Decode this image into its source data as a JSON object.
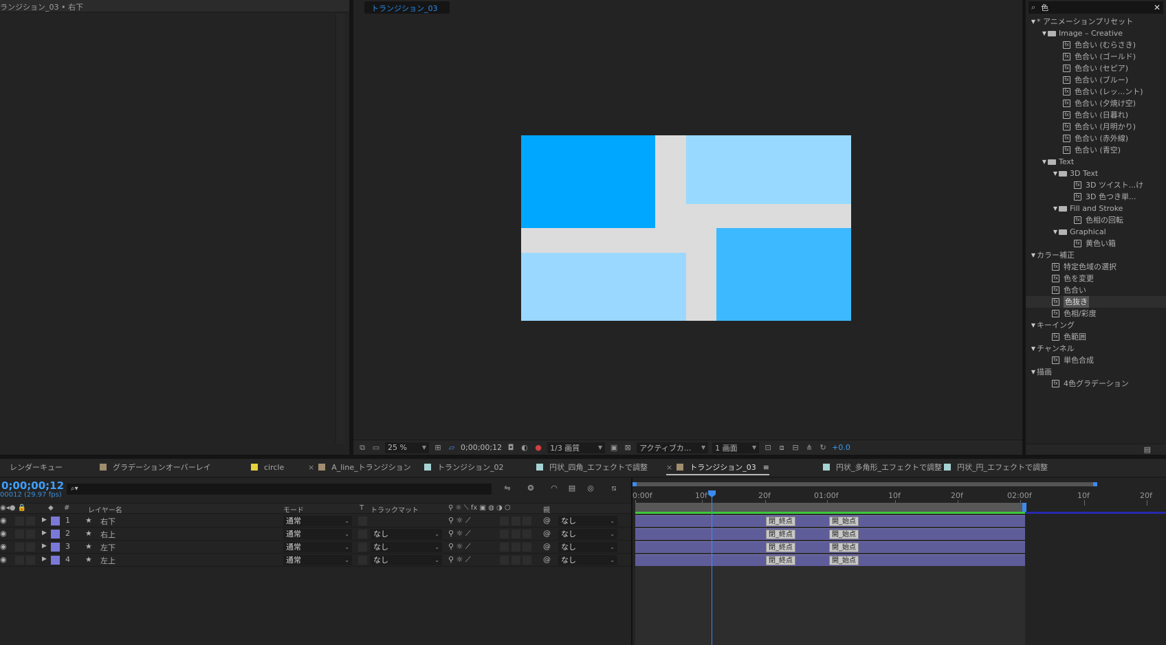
{
  "left_panel": {
    "header": "ランジション_03 • 右下"
  },
  "viewer": {
    "tab": "トランジション_03",
    "bar": {
      "zoom": "25 %",
      "timecode": "0;00;00;12",
      "resolution": "1/3 画質",
      "camera": "アクティブカ...",
      "views": "1 画面",
      "exposure": "+0.0"
    },
    "canvas_colors": {
      "top_left": "#00a7ff",
      "top_right": "#98d9ff",
      "bottom_left": "#9bd8ff",
      "bottom_right": "#3db9ff",
      "gap": "#dcdcdc"
    }
  },
  "effects": {
    "search_value": "色",
    "items": [
      {
        "label": "* アニメーションプリセット",
        "kind": "group",
        "indent": 0
      },
      {
        "label": "Image – Creative",
        "kind": "folder",
        "indent": 1
      },
      {
        "label": "色合い (むらさき)",
        "kind": "preset",
        "indent": 3
      },
      {
        "label": "色合い (ゴールド)",
        "kind": "preset",
        "indent": 3
      },
      {
        "label": "色合い (セピア)",
        "kind": "preset",
        "indent": 3
      },
      {
        "label": "色合い (ブルー)",
        "kind": "preset",
        "indent": 3
      },
      {
        "label": "色合い (レッ...ント)",
        "kind": "preset",
        "indent": 3
      },
      {
        "label": "色合い (夕焼け空)",
        "kind": "preset",
        "indent": 3
      },
      {
        "label": "色合い (日暮れ)",
        "kind": "preset",
        "indent": 3
      },
      {
        "label": "色合い (月明かり)",
        "kind": "preset",
        "indent": 3
      },
      {
        "label": "色合い (赤外線)",
        "kind": "preset",
        "indent": 3
      },
      {
        "label": "色合い (青空)",
        "kind": "preset",
        "indent": 3
      },
      {
        "label": "Text",
        "kind": "folder",
        "indent": 1
      },
      {
        "label": "3D Text",
        "kind": "folder",
        "indent": 2
      },
      {
        "label": "3D ツイスト...け",
        "kind": "preset",
        "indent": 4
      },
      {
        "label": "3D 色つき単...",
        "kind": "preset",
        "indent": 4
      },
      {
        "label": "Fill and Stroke",
        "kind": "folder",
        "indent": 2
      },
      {
        "label": "色相の回転",
        "kind": "preset",
        "indent": 4
      },
      {
        "label": "Graphical",
        "kind": "folder",
        "indent": 2
      },
      {
        "label": "黄色い箱",
        "kind": "preset",
        "indent": 4
      },
      {
        "label": "カラー補正",
        "kind": "group",
        "indent": 0
      },
      {
        "label": "特定色域の選択",
        "kind": "effect",
        "indent": 2
      },
      {
        "label": "色を変更",
        "kind": "effect",
        "indent": 2
      },
      {
        "label": "色合い",
        "kind": "effect",
        "indent": 2
      },
      {
        "label": "色抜き",
        "kind": "effect",
        "indent": 2,
        "highlight": true
      },
      {
        "label": "色相/彩度",
        "kind": "effect",
        "indent": 2
      },
      {
        "label": "キーイング",
        "kind": "group",
        "indent": 0
      },
      {
        "label": "色範囲",
        "kind": "effect",
        "indent": 2
      },
      {
        "label": "チャンネル",
        "kind": "group",
        "indent": 0
      },
      {
        "label": "単色合成",
        "kind": "effect",
        "indent": 2
      },
      {
        "label": "描画",
        "kind": "group",
        "indent": 0
      },
      {
        "label": "4色グラデーション",
        "kind": "effect",
        "indent": 2
      }
    ]
  },
  "comp_tabs": [
    {
      "label": "レンダーキュー",
      "swatch": ""
    },
    {
      "label": "グラデーションオーバーレイ",
      "swatch": "#a08c6e"
    },
    {
      "label": "circle",
      "swatch": "#e6d23c"
    },
    {
      "label": "A_line_トランジション",
      "swatch": "#a08c6e",
      "close": "×"
    },
    {
      "label": "トランジション_02",
      "swatch": "#a6d2d2"
    },
    {
      "label": "円状_四角_エフェクトで調整",
      "swatch": "#a6d2d2"
    },
    {
      "label": "トランジション_03",
      "swatch": "#a08c6e",
      "close": "×",
      "menu": "≡",
      "active": true
    },
    {
      "label": "円状_多角形_エフェクトで調整",
      "swatch": "#a6d2d2"
    },
    {
      "label": "円状_円_エフェクトで調整",
      "swatch": "#a6d2d2"
    }
  ],
  "timeline": {
    "timecode": "0;00;00;12",
    "fps": "00012 (29.97 fps)",
    "search_placeholder": "⌕▾",
    "columns": {
      "num": "#",
      "name": "レイヤー名",
      "mode": "モード",
      "t": "T",
      "trkmat": "トラックマット",
      "parent": "親"
    },
    "layers": [
      {
        "num": "1",
        "name": "右下",
        "mode": "通常",
        "trkmat": "",
        "parent": "なし"
      },
      {
        "num": "2",
        "name": "右上",
        "mode": "通常",
        "trkmat": "なし",
        "parent": "なし"
      },
      {
        "num": "3",
        "name": "左下",
        "mode": "通常",
        "trkmat": "なし",
        "parent": "なし"
      },
      {
        "num": "4",
        "name": "左上",
        "mode": "通常",
        "trkmat": "なし",
        "parent": "なし"
      }
    ],
    "ruler": [
      "0:00f",
      "10f",
      "20f",
      "01:00f",
      "10f",
      "20f",
      "02:00f",
      "10f",
      "20f"
    ],
    "keyframe_labels": {
      "end": "閉_終点",
      "start": "開_始点"
    },
    "label_color": "#7b79d8"
  }
}
